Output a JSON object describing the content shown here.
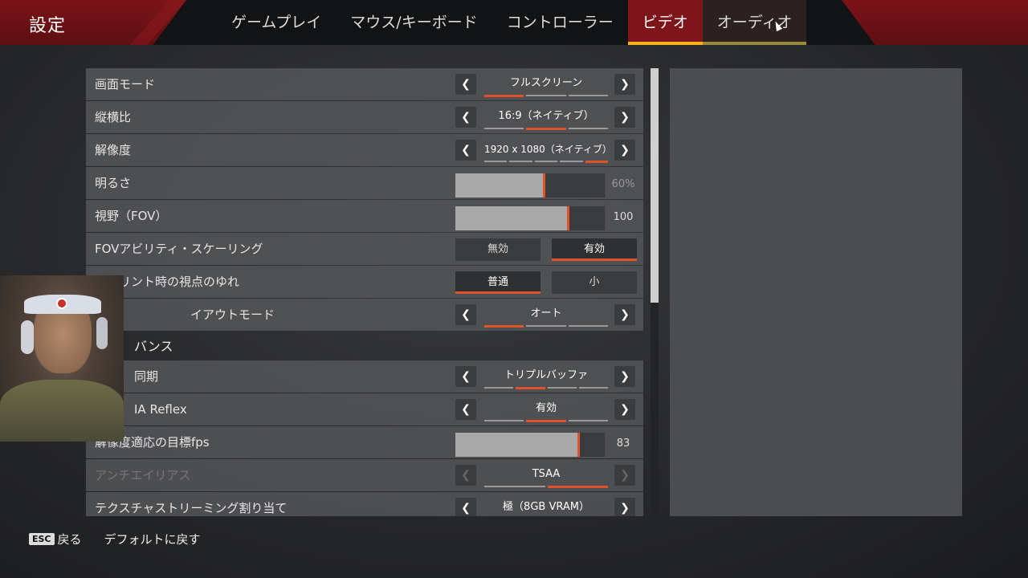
{
  "app": {
    "title": "設定"
  },
  "tabs": [
    {
      "label": "ゲームプレイ",
      "state": "normal"
    },
    {
      "label": "マウス/キーボード",
      "state": "normal"
    },
    {
      "label": "コントローラー",
      "state": "normal"
    },
    {
      "label": "ビデオ",
      "state": "active"
    },
    {
      "label": "オーディオ",
      "state": "hover"
    }
  ],
  "settings": {
    "display_mode": {
      "label": "画面モード",
      "value": "フルスクリーン",
      "option_count": 3,
      "selected_index": 0
    },
    "aspect_ratio": {
      "label": "縦横比",
      "value": "16:9（ネイティブ）",
      "option_count": 3,
      "selected_index": 1
    },
    "resolution": {
      "label": "解像度",
      "value": "1920 x 1080（ネイティブ）",
      "option_count": 5,
      "selected_index": 4
    },
    "brightness": {
      "label": "明るさ",
      "value": "60%",
      "fill_fraction": 0.6
    },
    "fov": {
      "label": "視野（FOV）",
      "value": "100",
      "fill_fraction": 0.76
    },
    "fov_ability_scaling": {
      "label": "FOVアビリティ・スケーリング",
      "options": [
        "無効",
        "有効"
      ],
      "selected": "有効"
    },
    "sprint_view_shake": {
      "label": "スプリント時の視点のゆれ",
      "options": [
        "普通",
        "小"
      ],
      "selected": "普通"
    },
    "layout_mode": {
      "label": "イアウトモード",
      "value": "オート",
      "option_count": 3,
      "selected_index": 0
    },
    "section_advanced": {
      "label": "バンス"
    },
    "vsync": {
      "label": "同期",
      "value": "トリプルバッファ",
      "option_count": 4,
      "selected_index": 1
    },
    "nvidia_reflex": {
      "label": "IA Reflex",
      "value": "有効",
      "option_count": 3,
      "selected_index": 1
    },
    "adaptive_resolution_fps": {
      "label": "解像度適応の目標fps",
      "value": "83",
      "fill_fraction": 0.83
    },
    "anti_aliasing": {
      "label": "アンチエイリアス",
      "value": "TSAA",
      "option_count": 2,
      "selected_index": 1,
      "disabled": true
    },
    "texture_streaming": {
      "label": "テクスチャストリーミング割り当て",
      "value": "極（8GB VRAM）"
    }
  },
  "footer": {
    "esc_key": "ESC",
    "back_label": "戻る",
    "reset_label": "デフォルトに戻す"
  },
  "colors": {
    "accent_red": "#7d151a",
    "tab_underline": "#f2b418",
    "indicator_orange": "#e0532a"
  }
}
